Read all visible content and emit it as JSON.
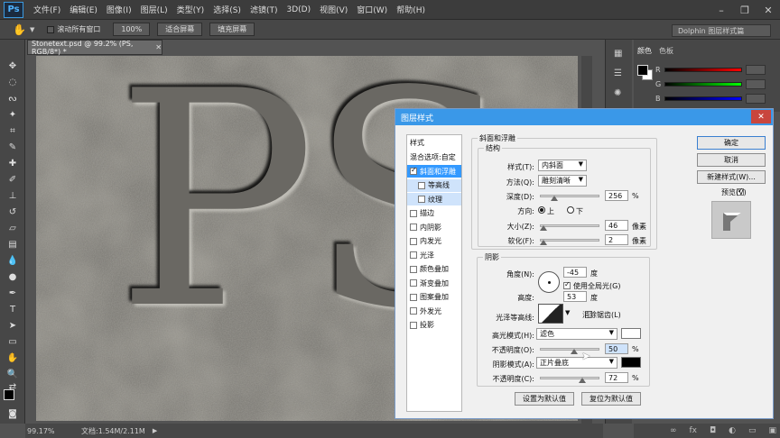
{
  "app": {
    "logo": "Ps",
    "menu": [
      "文件(F)",
      "编辑(E)",
      "图像(I)",
      "图层(L)",
      "类型(Y)",
      "选择(S)",
      "滤镜(T)",
      "3D(D)",
      "视图(V)",
      "窗口(W)",
      "帮助(H)"
    ]
  },
  "options": {
    "scroll_all": "滚动所有窗口",
    "zoom_100": "100%",
    "fit_screen": "适合屏幕",
    "fill_screen": "填充屏幕",
    "workspace": "Dolphin 图层样式篇"
  },
  "document": {
    "tab_title": "Stonetext.psd @ 99.2% (PS, RGB/8*) *",
    "canvas_text": "PS"
  },
  "status": {
    "zoom": "99.17%",
    "doc_size": "文档:1.54M/2.11M"
  },
  "panel": {
    "tab_color": "颜色",
    "tab_swatches": "色板",
    "r": "R",
    "g": "G",
    "b": "B"
  },
  "dialog": {
    "title": "图层样式",
    "styles_header": "样式",
    "blend_options": "混合选项:自定",
    "items": [
      {
        "label": "斜面和浮雕",
        "checked": true,
        "selected": true,
        "sub": false
      },
      {
        "label": "等高线",
        "checked": false,
        "selected": false,
        "sub": true
      },
      {
        "label": "纹理",
        "checked": false,
        "selected": false,
        "sub": true
      },
      {
        "label": "描边",
        "checked": false,
        "sub": false
      },
      {
        "label": "内阴影",
        "checked": false,
        "sub": false
      },
      {
        "label": "内发光",
        "checked": false,
        "sub": false
      },
      {
        "label": "光泽",
        "checked": false,
        "sub": false
      },
      {
        "label": "颜色叠加",
        "checked": false,
        "sub": false
      },
      {
        "label": "渐变叠加",
        "checked": false,
        "sub": false
      },
      {
        "label": "图案叠加",
        "checked": false,
        "sub": false
      },
      {
        "label": "外发光",
        "checked": false,
        "sub": false
      },
      {
        "label": "投影",
        "checked": false,
        "sub": false
      }
    ],
    "bevel": {
      "group": "斜面和浮雕",
      "structure": "结构",
      "style_label": "样式(T):",
      "style_value": "内斜面",
      "technique_label": "方法(Q):",
      "technique_value": "雕刻清晰",
      "depth_label": "深度(D):",
      "depth_value": "256",
      "depth_unit": "%",
      "direction_label": "方向:",
      "dir_up": "上",
      "dir_down": "下",
      "size_label": "大小(Z):",
      "size_value": "46",
      "size_unit": "像素",
      "soften_label": "软化(F):",
      "soften_value": "2",
      "soften_unit": "像素"
    },
    "shading": {
      "group": "阴影",
      "angle_label": "角度(N):",
      "angle_value": "-45",
      "angle_unit": "度",
      "global_light": "使用全局光(G)",
      "altitude_label": "高度:",
      "altitude_value": "53",
      "altitude_unit": "度",
      "gloss_label": "光泽等高线:",
      "anti_alias": "消除锯齿(L)",
      "highlight_label": "高光模式(H):",
      "highlight_value": "滤色",
      "hl_opacity_label": "不透明度(O):",
      "hl_opacity_value": "50",
      "percent": "%",
      "shadow_label": "阴影模式(A):",
      "shadow_value": "正片叠底",
      "sh_opacity_label": "不透明度(C):",
      "sh_opacity_value": "72"
    },
    "buttons": {
      "make_default": "设置为默认值",
      "reset_default": "复位为默认值",
      "ok": "确定",
      "cancel": "取消",
      "new_style": "新建样式(W)...",
      "preview": "预览(V)"
    }
  }
}
